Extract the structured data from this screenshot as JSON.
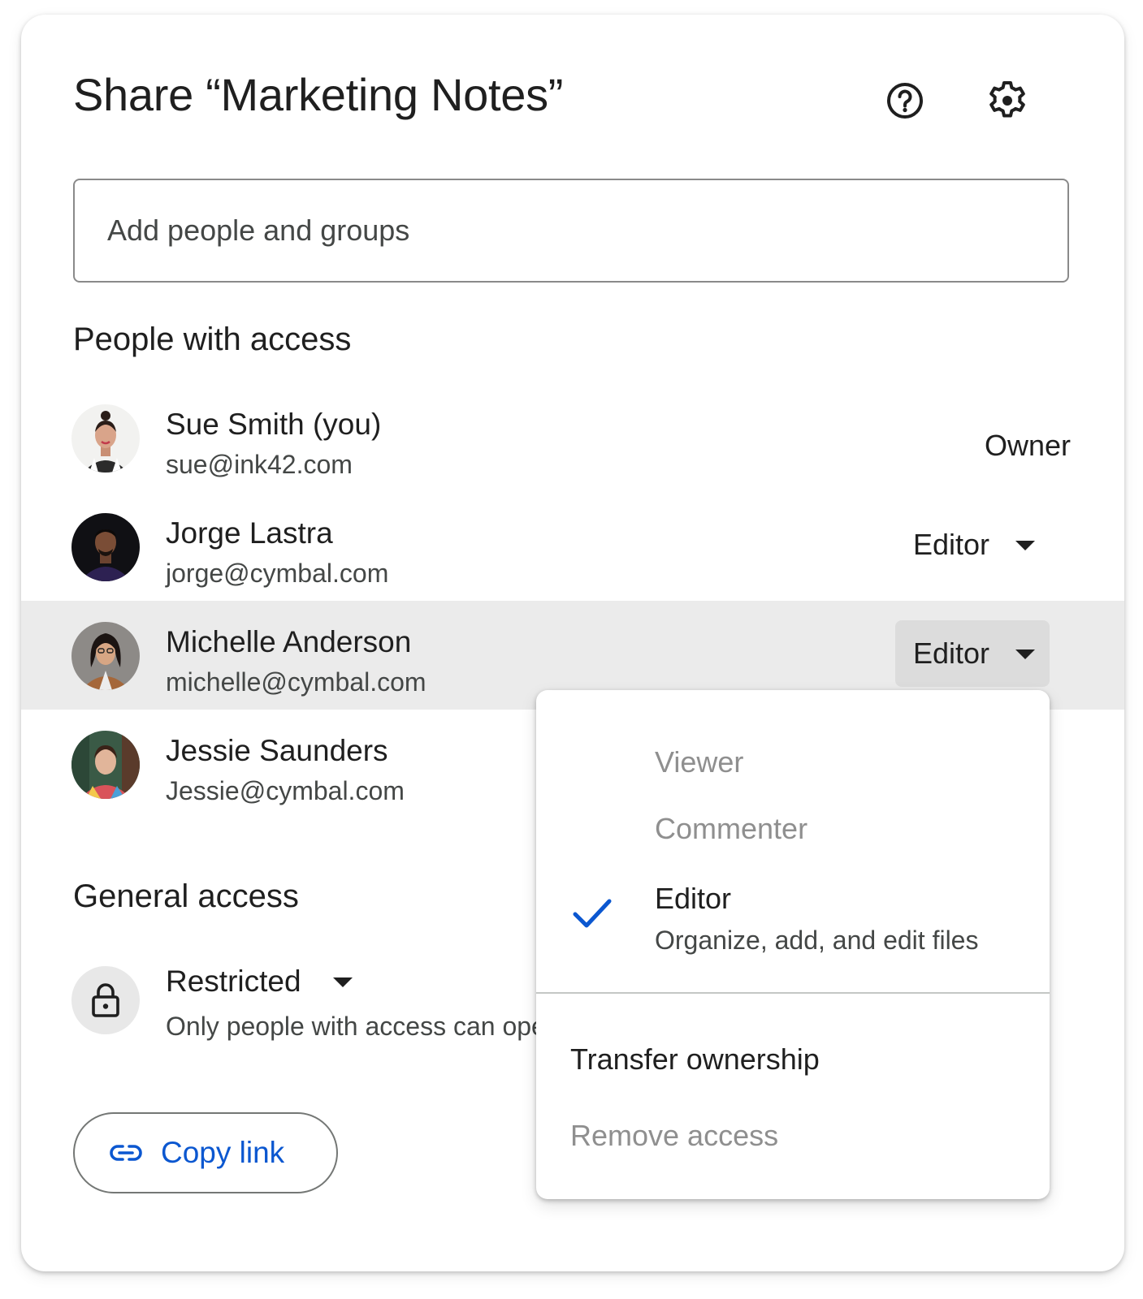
{
  "dialog": {
    "title": "Share “Marketing Notes”",
    "icons": [
      "help-icon",
      "settings-gear-icon"
    ]
  },
  "search": {
    "placeholder": "Add people and groups"
  },
  "people_section": {
    "title": "People with access",
    "people": [
      {
        "name": "Sue Smith (you)",
        "email": "sue@ink42.com",
        "role": "Owner"
      },
      {
        "name": "Jorge Lastra",
        "email": "jorge@cymbal.com",
        "role": "Editor"
      },
      {
        "name": "Michelle Anderson",
        "email": "michelle@cymbal.com",
        "role": "Editor"
      },
      {
        "name": "Jessie Saunders",
        "email": "Jessie@cymbal.com",
        "role": ""
      }
    ]
  },
  "general_access": {
    "title": "General access",
    "setting": "Restricted",
    "description": "Only people with access can open with the link"
  },
  "copy_link": {
    "label": "Copy link"
  },
  "role_menu": {
    "items": [
      {
        "label": "Viewer",
        "state": "disabled"
      },
      {
        "label": "Commenter",
        "state": "disabled"
      },
      {
        "label": "Editor",
        "description": "Organize, add, and edit files",
        "selected": true
      }
    ],
    "actions": [
      {
        "label": "Transfer ownership",
        "state": "enabled"
      },
      {
        "label": "Remove access",
        "state": "disabled"
      }
    ]
  },
  "colors": {
    "accent": "#0b57d0",
    "highlight_row": "#ebebeb",
    "text_primary": "#1f1f1f",
    "text_secondary": "#444746",
    "text_disabled": "#8f8f8f"
  }
}
